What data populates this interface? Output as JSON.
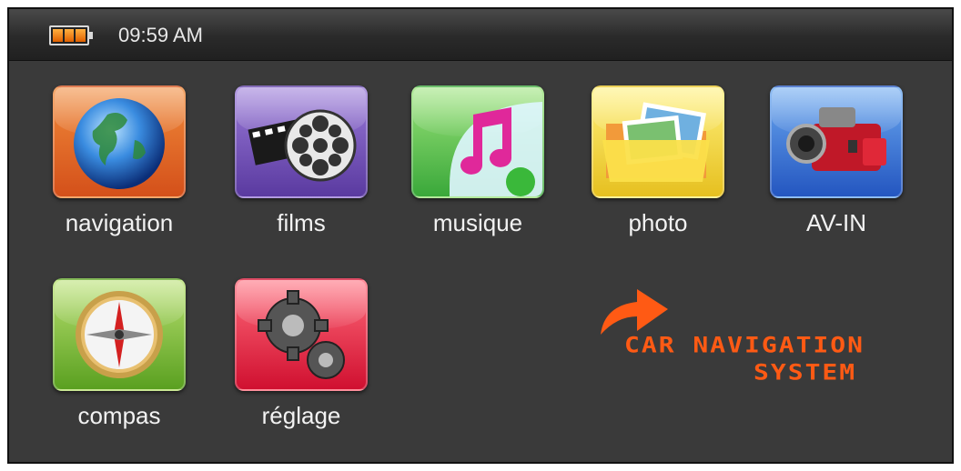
{
  "status_bar": {
    "time": "09:59 AM",
    "battery_icon": "battery-icon"
  },
  "apps": [
    {
      "label": "navigation",
      "icon": "globe-icon"
    },
    {
      "label": "films",
      "icon": "film-reel-icon"
    },
    {
      "label": "musique",
      "icon": "music-note-icon"
    },
    {
      "label": "photo",
      "icon": "photo-folder-icon"
    },
    {
      "label": "AV-IN",
      "icon": "camcorder-icon"
    },
    {
      "label": "compas",
      "icon": "compass-icon"
    },
    {
      "label": "réglage",
      "icon": "gears-icon"
    }
  ],
  "logo": {
    "line1": "CAR NAVIGATION",
    "line2": "SYSTEM",
    "icon": "arrow-icon",
    "color": "#ff5a14"
  }
}
